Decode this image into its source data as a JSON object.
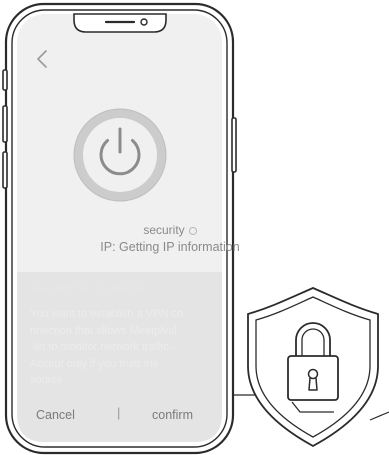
{
  "screen": {
    "security_label": "security",
    "ip_label": "IP: Getting IP information"
  },
  "sheet": {
    "title": "Request for connection",
    "body": "You want to establish a VPN co\nnnection that allows Meetplval\n-let to monitor network traffic.-\nAccept only if you trust the\nsource.",
    "cancel_label": "Cancel",
    "separator": "|",
    "confirm_label": "confirm"
  },
  "colors": {
    "phone_outline": "#2b2b2b",
    "screen_background": "#f0f0f0",
    "sheet_background": "#e4e4e4",
    "power_ring": "#c8c8c8",
    "power_stroke": "#8c8c8c"
  },
  "icons": {
    "back": "chevron-left-icon",
    "power": "power-icon",
    "security_status": "status-dot-icon",
    "badge": "shield-padlock-icon"
  }
}
